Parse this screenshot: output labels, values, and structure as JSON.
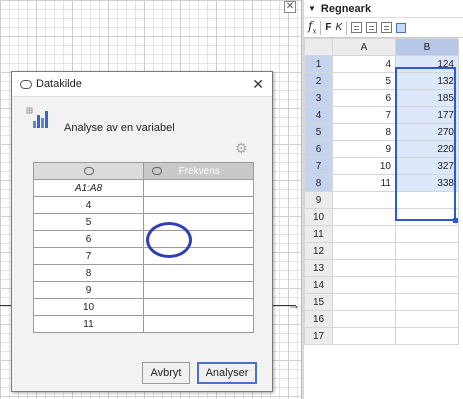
{
  "graphics": {
    "close_glyph": "✕",
    "axis_arrow_glyph": "→"
  },
  "spreadsheet": {
    "title": "Regneark",
    "title_arrow": "▼",
    "toolbar": {
      "fx": "f",
      "fx_sub": "x",
      "bold": "F",
      "italic": "K"
    },
    "columns": [
      "A",
      "B"
    ],
    "rows": [
      {
        "n": "1",
        "a": "4",
        "b": "124"
      },
      {
        "n": "2",
        "a": "5",
        "b": "132"
      },
      {
        "n": "3",
        "a": "6",
        "b": "185"
      },
      {
        "n": "4",
        "a": "7",
        "b": "177"
      },
      {
        "n": "5",
        "a": "8",
        "b": "270"
      },
      {
        "n": "6",
        "a": "9",
        "b": "220"
      },
      {
        "n": "7",
        "a": "10",
        "b": "327"
      },
      {
        "n": "8",
        "a": "11",
        "b": "338"
      },
      {
        "n": "9",
        "a": "",
        "b": ""
      },
      {
        "n": "10",
        "a": "",
        "b": ""
      },
      {
        "n": "11",
        "a": "",
        "b": ""
      },
      {
        "n": "12",
        "a": "",
        "b": ""
      },
      {
        "n": "13",
        "a": "",
        "b": ""
      },
      {
        "n": "14",
        "a": "",
        "b": ""
      },
      {
        "n": "15",
        "a": "",
        "b": ""
      },
      {
        "n": "16",
        "a": "",
        "b": ""
      },
      {
        "n": "17",
        "a": "",
        "b": ""
      }
    ],
    "selected_column": "B",
    "selection_color": "#2e58d6"
  },
  "dialog": {
    "title": "Datakilde",
    "close_glyph": "✕",
    "analysis_label": "Analyse av en variabel",
    "gear_glyph": "⚙",
    "table": {
      "col1_header_sub": "A1:A8",
      "col2_header": "Frekvens",
      "values": [
        "4",
        "5",
        "6",
        "7",
        "8",
        "9",
        "10",
        "11"
      ]
    },
    "cancel_label": "Avbryt",
    "analyze_label": "Analyser",
    "highlight_color": "#2f41b3"
  }
}
